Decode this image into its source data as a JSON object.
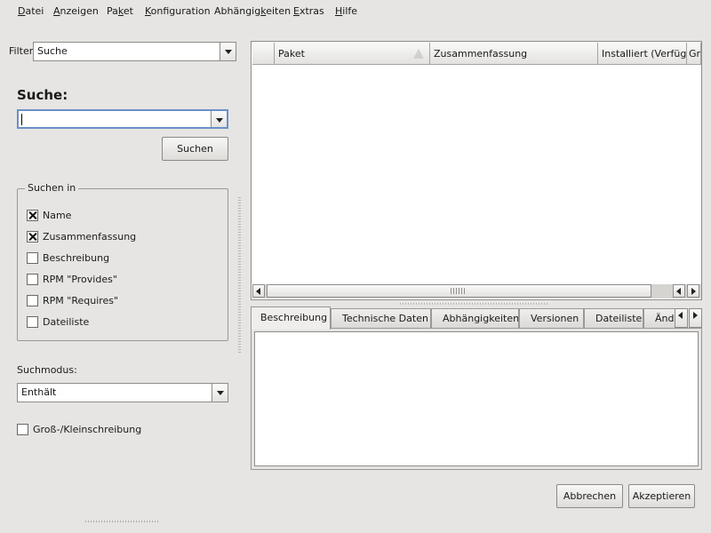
{
  "menubar": {
    "items": [
      {
        "label": "Datei",
        "mnemonic_index": 0
      },
      {
        "label": "Anzeigen",
        "mnemonic_index": 0
      },
      {
        "label": "Paket",
        "mnemonic_index": 2
      },
      {
        "label": "Konfiguration",
        "mnemonic_index": 0
      },
      {
        "label": "Abhängigkeiten",
        "mnemonic_index": 8
      },
      {
        "label": "Extras",
        "mnemonic_index": 0
      },
      {
        "label": "Hilfe",
        "mnemonic_index": 0
      }
    ]
  },
  "filter": {
    "label": "Filter:",
    "value": "Suche"
  },
  "search": {
    "heading": "Suche:",
    "input_value": "",
    "button_label": "Suchen"
  },
  "search_in": {
    "title": "Suchen in",
    "options": [
      {
        "label": "Name",
        "checked": true
      },
      {
        "label": "Zusammenfassung",
        "checked": true
      },
      {
        "label": "Beschreibung",
        "checked": false
      },
      {
        "label": "RPM \"Provides\"",
        "checked": false
      },
      {
        "label": "RPM \"Requires\"",
        "checked": false
      },
      {
        "label": "Dateiliste",
        "checked": false
      }
    ]
  },
  "search_mode": {
    "label": "Suchmodus:",
    "value": "Enthält"
  },
  "case_sensitive": {
    "label": "Groß-/Kleinschreibung",
    "checked": false
  },
  "table": {
    "columns": [
      "",
      "Paket",
      "Zusammenfassung",
      "Installiert (Verfügbar)",
      "Größe"
    ],
    "rows": []
  },
  "tabs": [
    "Beschreibung",
    "Technische Daten",
    "Abhängigkeiten",
    "Versionen",
    "Dateiliste",
    "Änderungsprotokoll"
  ],
  "active_tab": 0,
  "footer": {
    "cancel_label": "Abbrechen",
    "accept_label": "Akzeptieren"
  },
  "colors": {
    "background": "#e6e5e3",
    "input_focus": "#6b8fc8"
  }
}
